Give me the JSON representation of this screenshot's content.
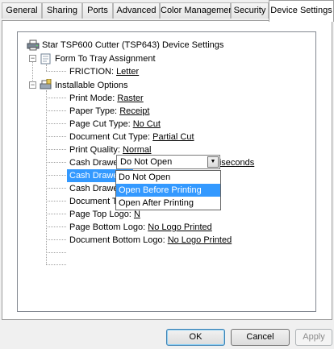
{
  "tabs": [
    {
      "label": "General"
    },
    {
      "label": "Sharing"
    },
    {
      "label": "Ports"
    },
    {
      "label": "Advanced"
    },
    {
      "label": "Color Management"
    },
    {
      "label": "Security"
    },
    {
      "label": "Device Settings"
    }
  ],
  "active_tab": "Device Settings",
  "tree": {
    "root": "Star TSP600 Cutter (TSP643) Device Settings",
    "form_to_tray": "Form To Tray Assignment",
    "friction_label": "FRICTION:",
    "friction_value": "Letter",
    "installable_options": "Installable Options",
    "print_mode_label": "Print Mode:",
    "print_mode_value": "Raster",
    "paper_type_label": "Paper Type:",
    "paper_type_value": "Receipt",
    "page_cut_label": "Page Cut Type:",
    "page_cut_value": "No Cut",
    "doc_cut_label": "Document Cut Type:",
    "doc_cut_value": "Partial Cut",
    "print_quality_label": "Print Quality:",
    "print_quality_value": "Normal",
    "drawer_pulse_label": "Cash Drawer 1 - Pulse Width:",
    "drawer_pulse_value": "200 milliseconds",
    "drawer1_label": "Cash Drawer 1:",
    "drawer2_label": "Cash Drawer 2:",
    "drawer2_value": "D",
    "doc_top_logo_label": "Document Top L",
    "page_top_logo_label": "Page Top Logo:",
    "page_top_logo_value": "N",
    "page_bottom_logo_label": "Page Bottom Logo:",
    "page_bottom_logo_value": "No Logo Printed",
    "doc_bottom_logo_label": "Document Bottom Logo:",
    "doc_bottom_logo_value": "No Logo Printed"
  },
  "combo": {
    "selected": "Do Not Open",
    "options": [
      "Do Not Open",
      "Open Before Printing",
      "Open After Printing"
    ],
    "highlighted": "Open Before Printing"
  },
  "buttons": {
    "ok": "OK",
    "cancel": "Cancel",
    "apply": "Apply"
  },
  "colors": {
    "selection": "#3399ff",
    "window_bg": "#f0f0f0"
  }
}
